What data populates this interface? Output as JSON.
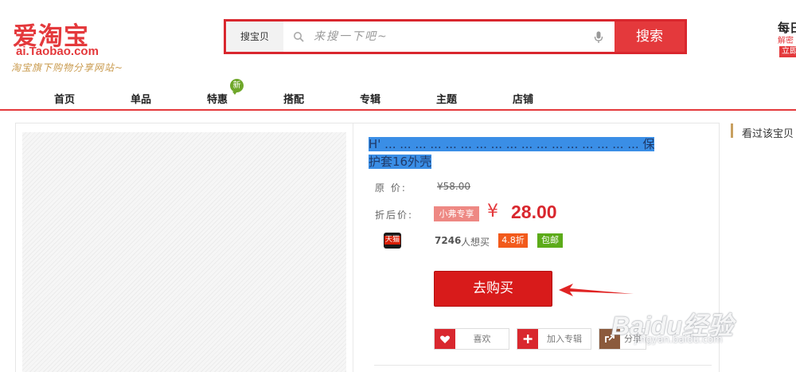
{
  "header": {
    "logo_main": "爱淘宝",
    "logo_sub": "ai.Taobao.com",
    "logo_slogan": "淘宝旗下购物分享网站~",
    "search": {
      "type_label": "搜宝贝",
      "placeholder": "来搜一下吧~",
      "button_label": "搜索"
    },
    "daily": {
      "title": "每日",
      "desc": "解密",
      "button": "立即"
    }
  },
  "nav": {
    "items": [
      "首页",
      "单品",
      "特惠",
      "搭配",
      "专辑",
      "主题",
      "店铺"
    ],
    "badge": "新"
  },
  "product": {
    "title_line1": "H' ... ... ... ... ... ... ... ... ... ... ... ... ... ... ... ... ... 保",
    "title_line2": "护套16外壳",
    "orig_label": "原  价:",
    "orig_price": "¥58.00",
    "sale_label": "折后价:",
    "vip_tag": "小弗专享",
    "currency": "¥",
    "price": "28.00",
    "shop_badge": "天猫",
    "want_count": "7246",
    "want_text": "人想买",
    "discount_tag": "4.8折",
    "freeship_tag": "包邮",
    "buy_button": "去购买",
    "actions": {
      "like": "喜欢",
      "add_album": "加入专辑",
      "share": "分享"
    }
  },
  "sidebar": {
    "title": "看过该宝贝"
  },
  "watermark": {
    "brand": "Baidu经验",
    "url": "jingyan.baidu.com"
  },
  "colors": {
    "accent": "#e4393c",
    "price": "#d9272e",
    "discount": "#f25a1b",
    "freeship": "#5cab19",
    "vip": "#ee8883"
  }
}
